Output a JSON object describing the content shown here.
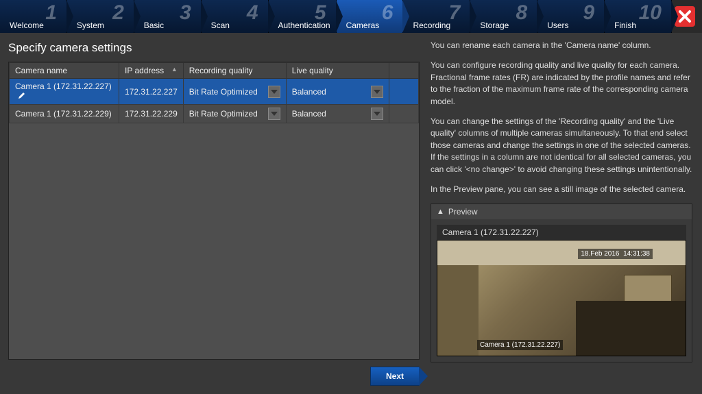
{
  "steps": [
    {
      "num": "1",
      "label": "Welcome"
    },
    {
      "num": "2",
      "label": "System"
    },
    {
      "num": "3",
      "label": "Basic"
    },
    {
      "num": "4",
      "label": "Scan"
    },
    {
      "num": "5",
      "label": "Authentication"
    },
    {
      "num": "6",
      "label": "Cameras"
    },
    {
      "num": "7",
      "label": "Recording"
    },
    {
      "num": "8",
      "label": "Storage"
    },
    {
      "num": "9",
      "label": "Users"
    },
    {
      "num": "10",
      "label": "Finish"
    }
  ],
  "active_step_index": 5,
  "page_title": "Specify camera settings",
  "columns": {
    "name": "Camera name",
    "ip": "IP address",
    "rec": "Recording quality",
    "live": "Live quality"
  },
  "rows": [
    {
      "name": "Camera 1 (172.31.22.227)",
      "ip": "172.31.22.227",
      "rec": "Bit Rate Optimized",
      "live": "Balanced",
      "selected": true
    },
    {
      "name": "Camera 1 (172.31.22.229)",
      "ip": "172.31.22.229",
      "rec": "Bit Rate Optimized",
      "live": "Balanced",
      "selected": false
    }
  ],
  "next_button": "Next",
  "help": {
    "p1": "You can rename each camera in the 'Camera name' column.",
    "p2": "You can configure recording quality and live quality for each camera. Fractional frame rates (FR) are indicated by the profile names and refer to the fraction of the maximum frame rate of the corresponding camera model.",
    "p3": "You can change the settings of the 'Recording quality' and the 'Live quality' columns of multiple cameras simultaneously. To that end select those cameras and change the settings in one of the selected cameras. If the settings in a column are not identical for all selected cameras, you can click '<no change>' to avoid changing these settings unintentionally.",
    "p4": "In the Preview pane, you can see a still image of the selected camera."
  },
  "preview": {
    "header": "Preview",
    "camera_label": "Camera 1 (172.31.22.227)",
    "timestamp_date": "18.Feb 2016",
    "timestamp_time": "14:31:38",
    "overlay_label": "Camera 1 (172.31.22.227)"
  }
}
